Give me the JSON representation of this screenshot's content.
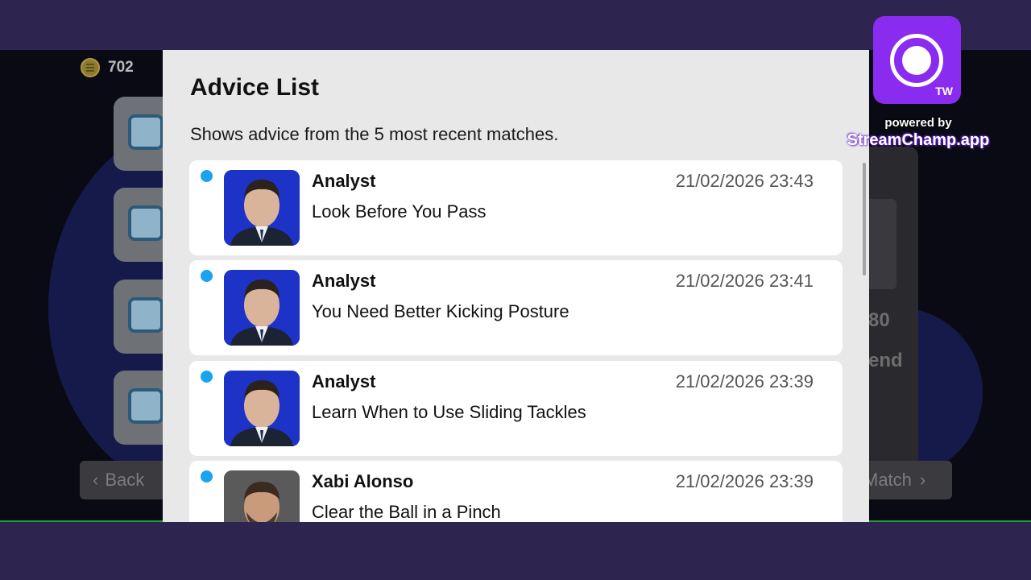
{
  "background": {
    "coins": "702",
    "back_button": "Back",
    "right_value": "80",
    "right_label": "end",
    "match_button": "Match"
  },
  "modal": {
    "title": "Advice List",
    "subtitle": "Shows advice from the 5 most recent matches.",
    "items": [
      {
        "author": "Analyst",
        "text": "Look Before You Pass",
        "time": "21/02/2026 23:43",
        "avatar": "analyst-avatar",
        "unread": true
      },
      {
        "author": "Analyst",
        "text": "You Need Better Kicking Posture",
        "time": "21/02/2026 23:41",
        "avatar": "analyst-avatar",
        "unread": true
      },
      {
        "author": "Analyst",
        "text": "Learn When to Use Sliding Tackles",
        "time": "21/02/2026 23:39",
        "avatar": "analyst-avatar",
        "unread": true
      },
      {
        "author": "Xabi Alonso",
        "text": "Clear the Ball in a Pinch",
        "time": "21/02/2026 23:39",
        "avatar": "xabi-alonso-avatar",
        "unread": true
      }
    ]
  },
  "overlay": {
    "badge": "TW",
    "powered_by": "powered by",
    "brand": "StreamChamp.app"
  },
  "colors": {
    "frame": "#2e2450",
    "unread_dot": "#1aa3f0",
    "brand": "#8a2cf0"
  }
}
